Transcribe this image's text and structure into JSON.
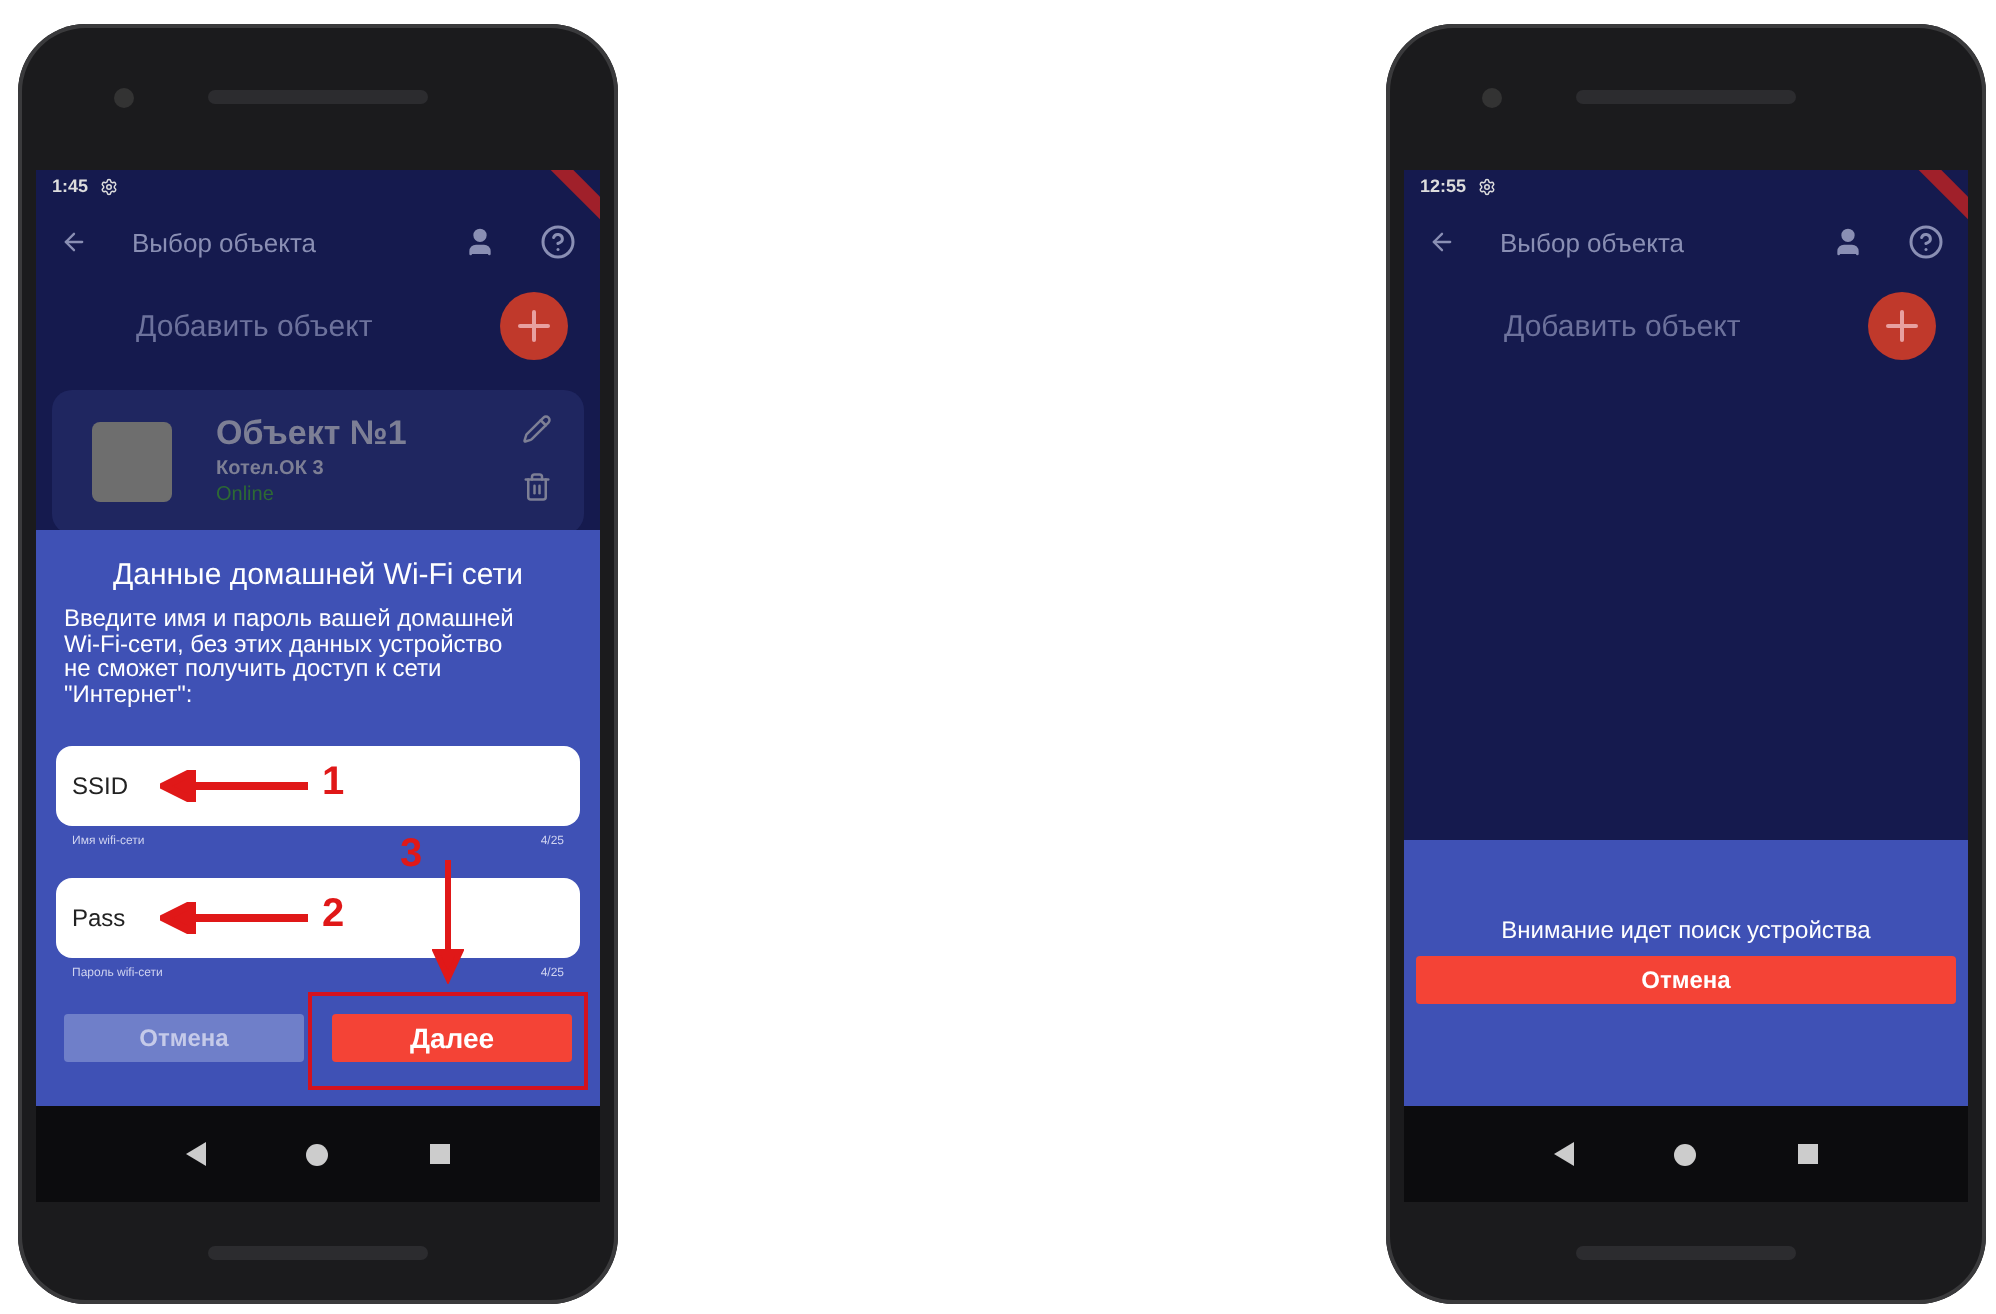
{
  "phones": [
    {
      "status_bar": {
        "time": "1:45"
      },
      "app_bar": {
        "title": "Выбор объекта"
      },
      "add_object": {
        "label": "Добавить объект"
      },
      "objects": [
        {
          "name": "Объект №1",
          "model": "Котел.ОК 3",
          "status": "Online"
        }
      ],
      "dialog": {
        "kind": "wifi",
        "title": "Данные домашней Wi-Fi сети",
        "text": "Введите имя и пароль вашей домашней Wi-Fi-сети, без этих данных устройство не сможет получить доступ к сети \"Интернет\":",
        "fields": [
          {
            "value": "SSID",
            "helper": "Имя wifi-сети",
            "counter": "4/25"
          },
          {
            "value": "Pass",
            "helper": "Пароль wifi-сети",
            "counter": "4/25"
          }
        ],
        "buttons": [
          {
            "label": "Отмена",
            "kind": "secondary"
          },
          {
            "label": "Далее",
            "kind": "primary"
          }
        ]
      },
      "annotations": [
        {
          "kind": "left",
          "label": "1"
        },
        {
          "kind": "left",
          "label": "2"
        },
        {
          "kind": "down",
          "label": "3"
        }
      ]
    },
    {
      "status_bar": {
        "time": "12:55"
      },
      "app_bar": {
        "title": "Выбор объекта"
      },
      "add_object": {
        "label": "Добавить объект"
      },
      "dialog": {
        "kind": "search",
        "text": "Внимание идет поиск устройства",
        "buttons": [
          {
            "label": "Отмена",
            "kind": "danger"
          }
        ]
      }
    }
  ]
}
